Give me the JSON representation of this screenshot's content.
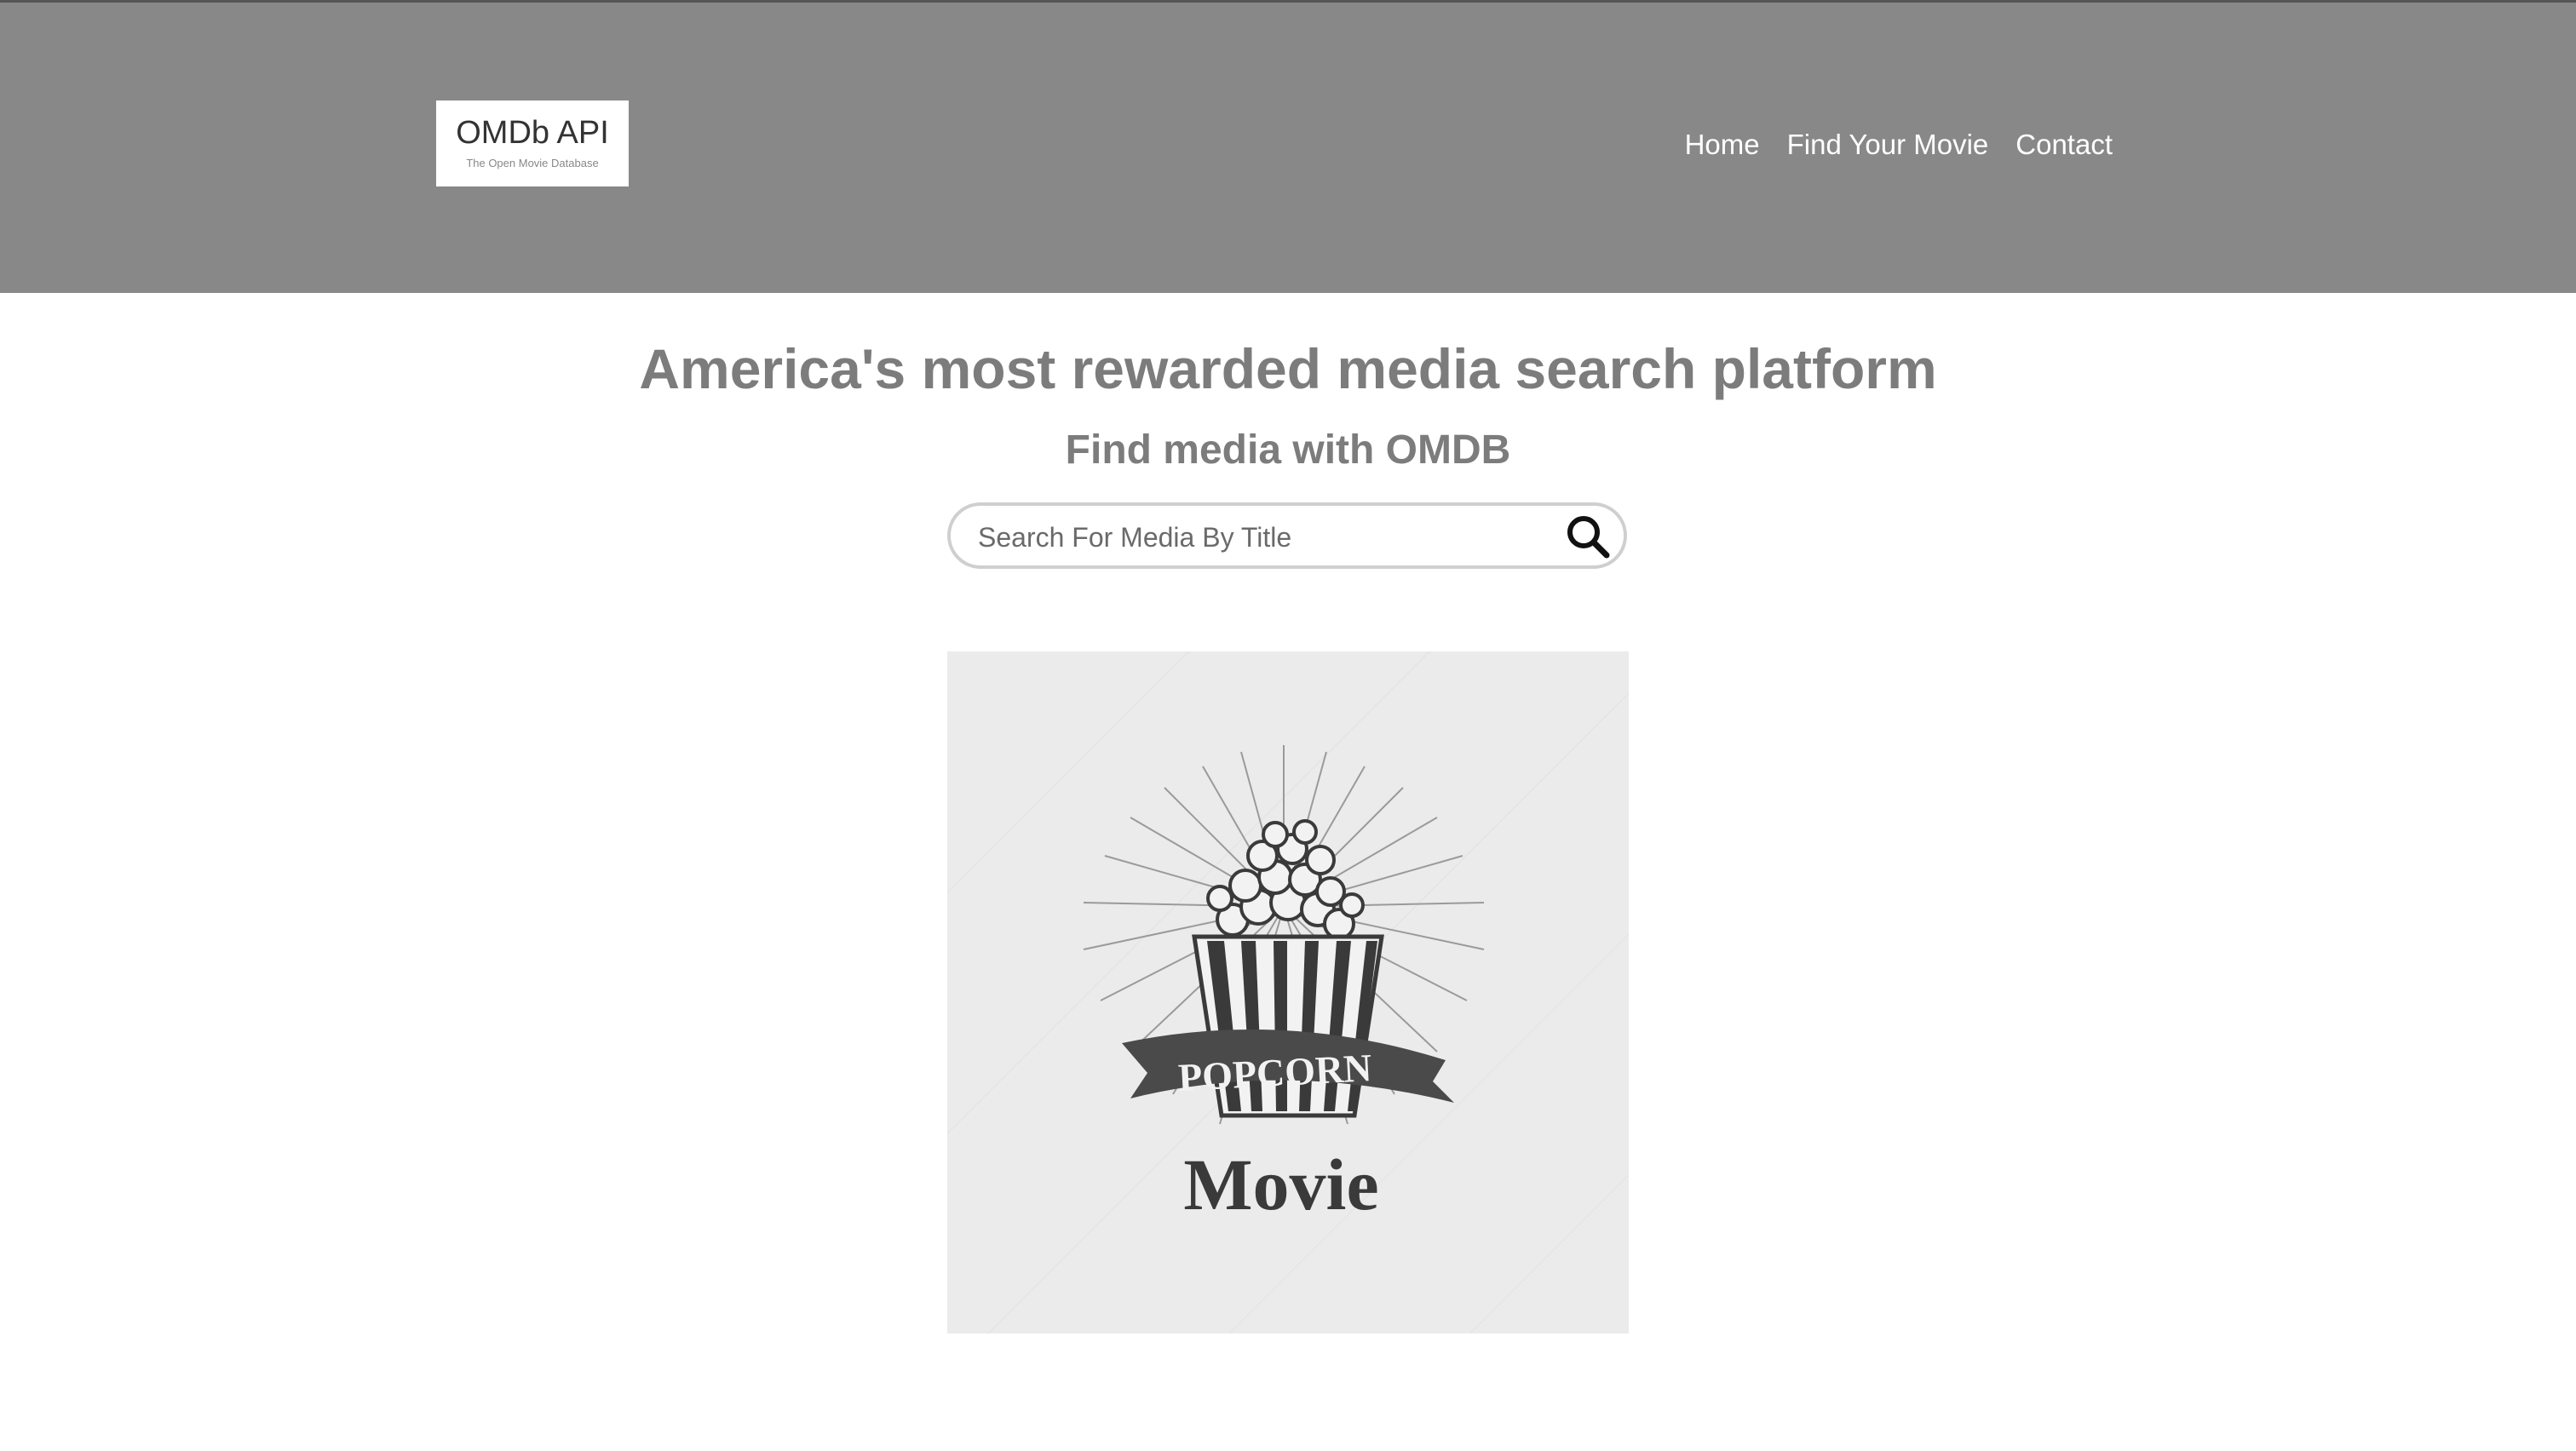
{
  "header": {
    "background_color": "#888888",
    "logo": {
      "title": "OMDb API",
      "subtitle": "The Open Movie Database"
    },
    "nav": [
      {
        "label": "Home"
      },
      {
        "label": "Find Your Movie"
      },
      {
        "label": "Contact"
      }
    ]
  },
  "main": {
    "headline": "America's most rewarded media search platform",
    "subheadline": "Find media with OMDB",
    "search": {
      "placeholder": "Search For Media By Title",
      "value": "",
      "icon": "search-icon"
    },
    "poster": {
      "icon": "popcorn-icon",
      "banner_text": "POPCORN",
      "bottom_text": "Movie"
    }
  }
}
